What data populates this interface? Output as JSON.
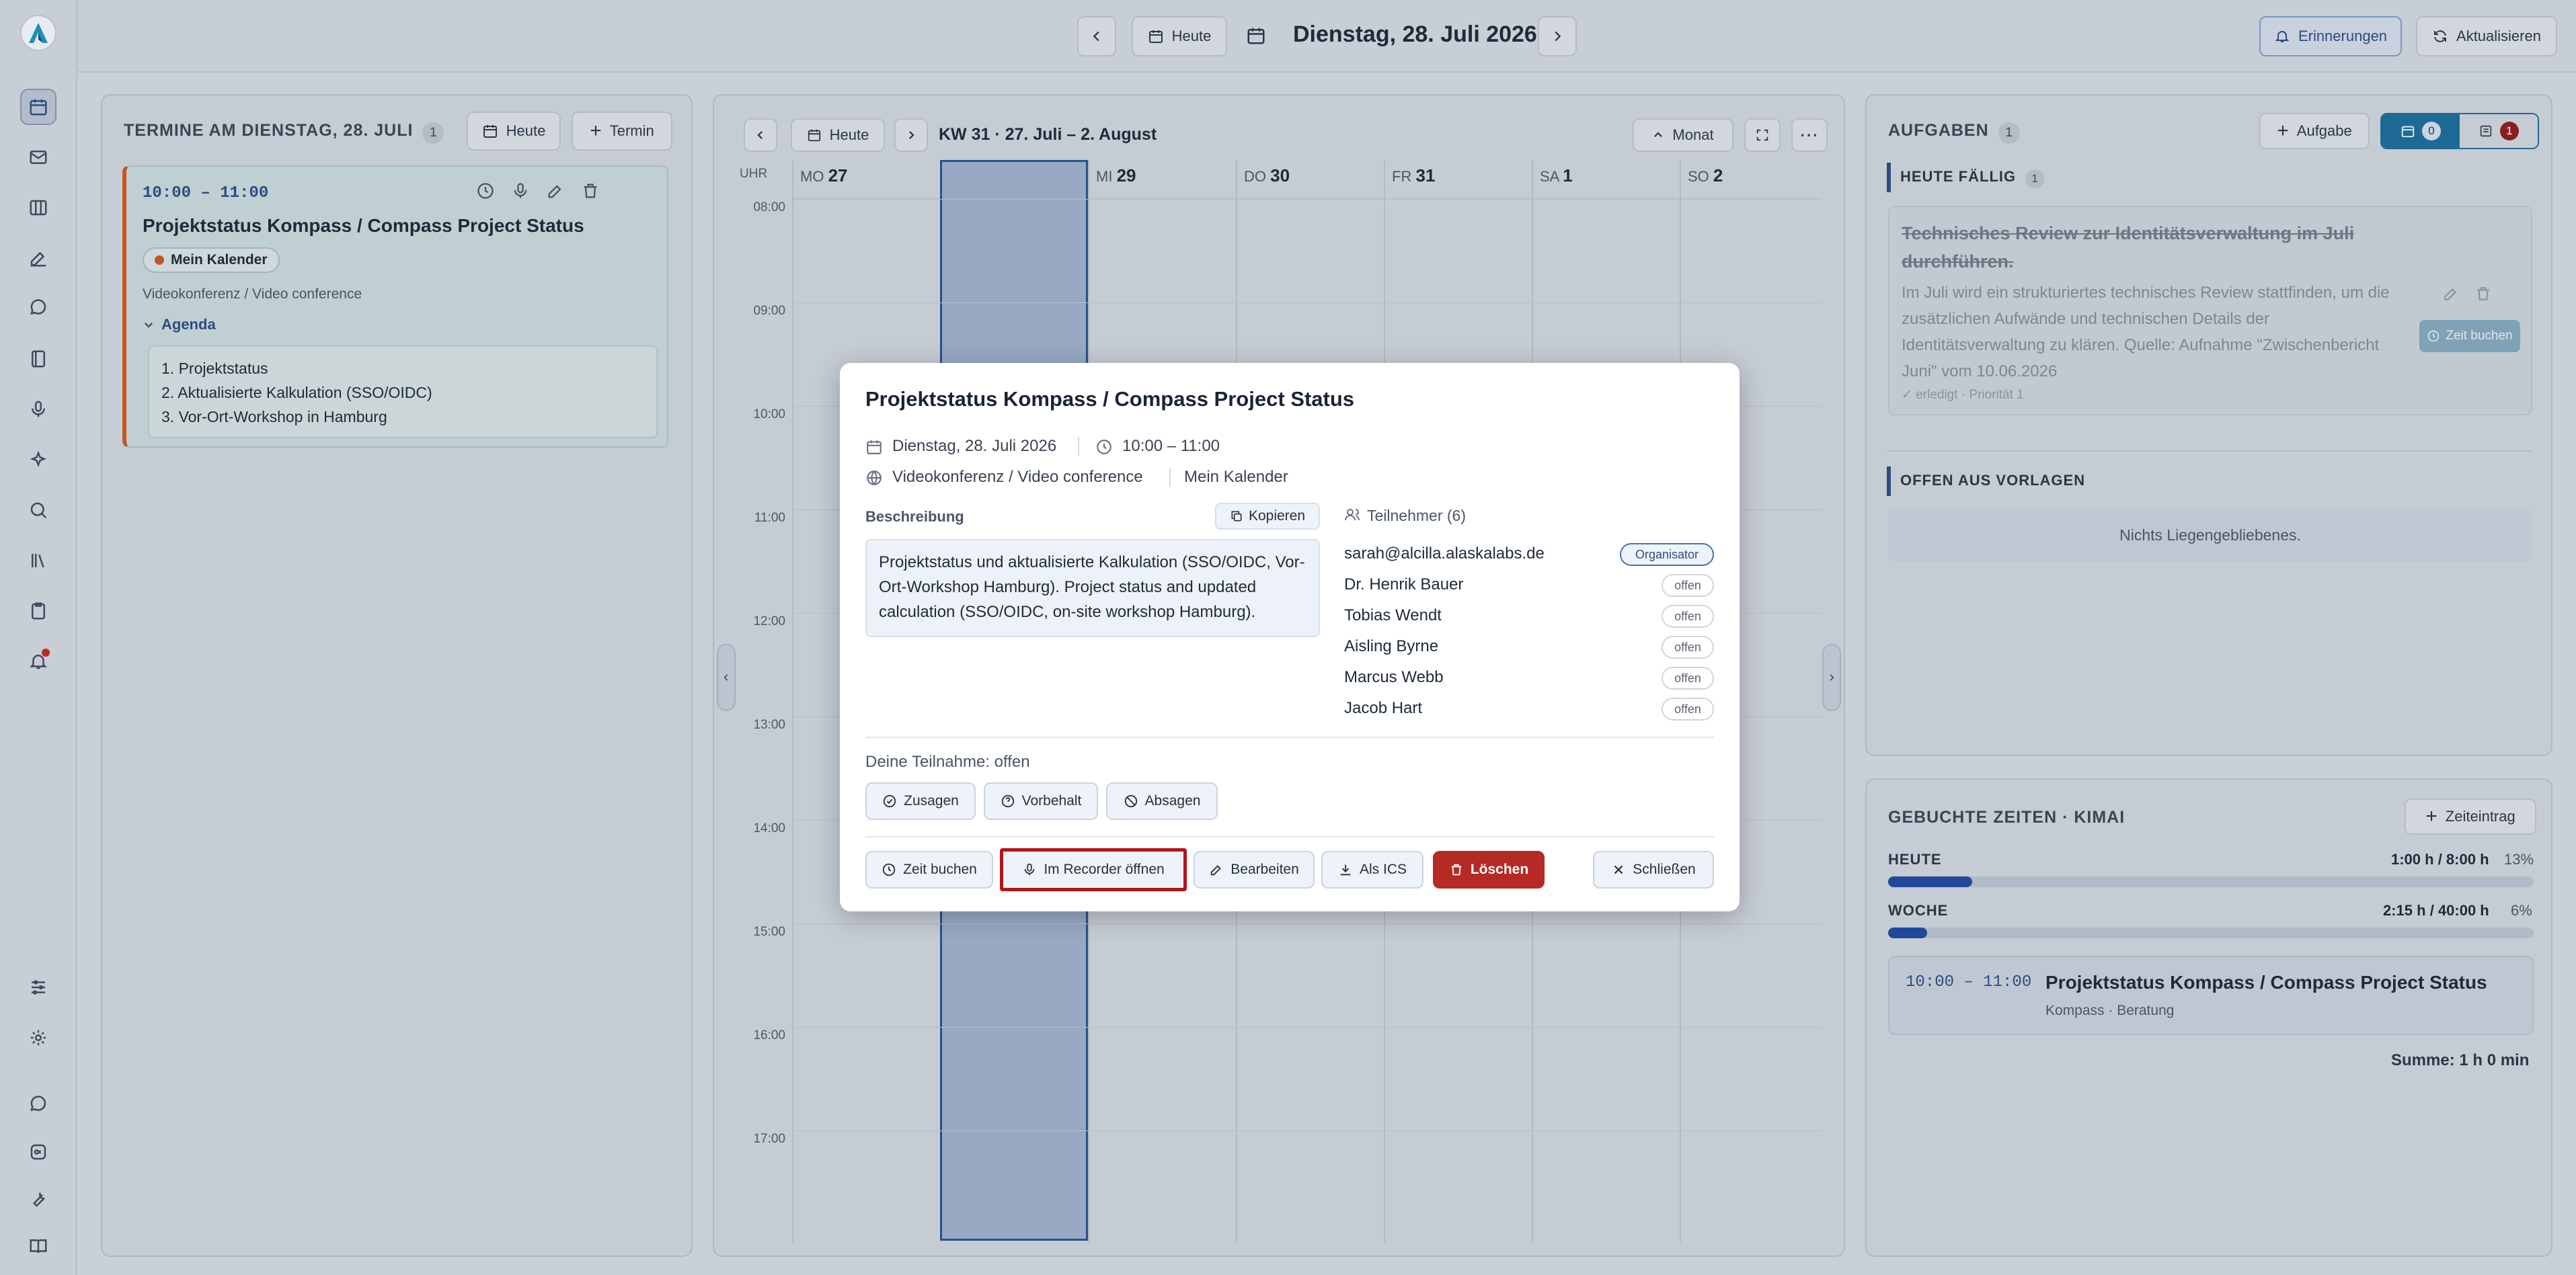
{
  "topbar": {
    "today": "Heute",
    "date_title": "Dienstag, 28. Juli 2026",
    "reminders": "Erinnerungen",
    "refresh": "Aktualisieren"
  },
  "appointments": {
    "title": "TERMINE AM DIENSTAG, 28. JULI",
    "count": "1",
    "today_btn": "Heute",
    "add_btn": "Termin",
    "card": {
      "time": "10:00 – 11:00",
      "title": "Projektstatus Kompass / Compass Project Status",
      "calendar": "Mein Kalender",
      "location": "Videokonferenz / Video conference",
      "agenda_label": "Agenda",
      "agenda_items": [
        "1. Projektstatus",
        "2. Aktualisierte Kalkulation (SSO/OIDC)",
        "3. Vor-Ort-Workshop in Hamburg"
      ]
    }
  },
  "calendar": {
    "today_btn": "Heute",
    "week_label": "KW 31 · 27. Juli – 2. August",
    "view": "Monat",
    "uhr": "UHR",
    "days": [
      {
        "wd": "MO",
        "d": "27"
      },
      {
        "wd": "DI",
        "d": "28"
      },
      {
        "wd": "MI",
        "d": "29"
      },
      {
        "wd": "DO",
        "d": "30"
      },
      {
        "wd": "FR",
        "d": "31"
      },
      {
        "wd": "SA",
        "d": "1"
      },
      {
        "wd": "SO",
        "d": "2"
      }
    ],
    "hours": [
      "08:00",
      "09:00",
      "10:00",
      "11:00",
      "12:00",
      "13:00",
      "14:00",
      "15:00",
      "16:00",
      "17:00"
    ]
  },
  "tasks": {
    "title": "AUFGABEN",
    "count": "1",
    "add_btn": "Aufgabe",
    "tab1_count": "0",
    "tab2_count": "1",
    "due_label": "HEUTE FÄLLIG",
    "due_count": "1",
    "item": {
      "title": "Technisches Review zur Identitätsverwaltung im Juli durchführen.",
      "body": "Im Juli wird ein strukturiertes technisches Review stattfinden, um die zusätzlichen Aufwände und technischen Details der Identitätsverwaltung zu klären. Quelle: Aufnahme \"Zwischenbericht Juni\" vom 10.06.2026",
      "meta": "✓ erledigt · Priorität 1",
      "book_btn": "Zeit buchen"
    },
    "open_label": "OFFEN AUS VORLAGEN",
    "empty": "Nichts Liegengebliebenes."
  },
  "times": {
    "title": "GEBUCHTE ZEITEN · KIMAI",
    "add_btn": "Zeiteintrag",
    "today_label": "HEUTE",
    "today_value": "1:00 h / 8:00 h",
    "today_pct": "13%",
    "today_fraction": 0.13,
    "week_label": "WOCHE",
    "week_value": "2:15 h / 40:00 h",
    "week_pct": "6%",
    "week_fraction": 0.06,
    "entry_time": "10:00 – 11:00",
    "entry_title": "Projektstatus Kompass / Compass Project Status",
    "entry_sub": "Kompass · Beratung",
    "sum": "Summe: 1 h 0 min"
  },
  "modal": {
    "title": "Projektstatus Kompass / Compass Project Status",
    "date": "Dienstag, 28. Juli 2026",
    "time": "10:00 – 11:00",
    "location": "Videokonferenz / Video conference",
    "calendar": "Mein Kalender",
    "desc_label": "Beschreibung",
    "copy_btn": "Kopieren",
    "description": "Projektstatus und aktualisierte Kalkulation (SSO/OIDC, Vor-Ort-Workshop Hamburg). Project status and updated calculation (SSO/OIDC, on-site workshop Hamburg).",
    "participants_label": "Teilnehmer (6)",
    "participants": [
      {
        "name": "sarah@alcilla.alaskalabs.de",
        "status": "Organisator"
      },
      {
        "name": "Dr. Henrik Bauer",
        "status": "offen"
      },
      {
        "name": "Tobias Wendt",
        "status": "offen"
      },
      {
        "name": "Aisling Byrne",
        "status": "offen"
      },
      {
        "name": "Marcus Webb",
        "status": "offen"
      },
      {
        "name": "Jacob Hart",
        "status": "offen"
      }
    ],
    "participation": "Deine Teilnahme: offen",
    "accept": "Zusagen",
    "tentative": "Vorbehalt",
    "decline": "Absagen",
    "book_time": "Zeit buchen",
    "open_recorder": "Im Recorder öffnen",
    "edit": "Bearbeiten",
    "ics": "Als ICS",
    "delete": "Löschen",
    "close": "Schließen"
  }
}
